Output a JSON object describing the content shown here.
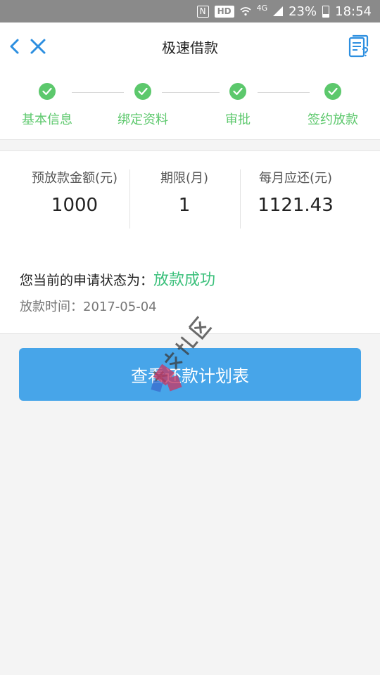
{
  "status_bar": {
    "nfc": "N",
    "hd": "HD",
    "network": "4G",
    "battery_percent": "23%",
    "time": "18:54"
  },
  "header": {
    "title": "极速借款",
    "icons": [
      "back-chevron-icon",
      "close-icon",
      "document-help-icon"
    ]
  },
  "steps": [
    {
      "label": "基本信息",
      "done": true
    },
    {
      "label": "绑定资料",
      "done": true
    },
    {
      "label": "审批",
      "done": true
    },
    {
      "label": "签约放款",
      "done": true
    }
  ],
  "summary": [
    {
      "label": "预放款金额(元)",
      "value": "1000"
    },
    {
      "label": "期限(月)",
      "value": "1"
    },
    {
      "label": "每月应还(元)",
      "value": "1121.43"
    }
  ],
  "status": {
    "prefix": "您当前的申请状态为：",
    "state": "放款成功",
    "time_label": "放款时间：",
    "time_value": "2017-05-04"
  },
  "action_button": {
    "label": "查看还款计划表"
  },
  "colors": {
    "accent_green": "#5cc86c",
    "status_green": "#3bc07b",
    "button_blue": "#47a5e9",
    "icon_blue": "#2d8fe0"
  }
}
